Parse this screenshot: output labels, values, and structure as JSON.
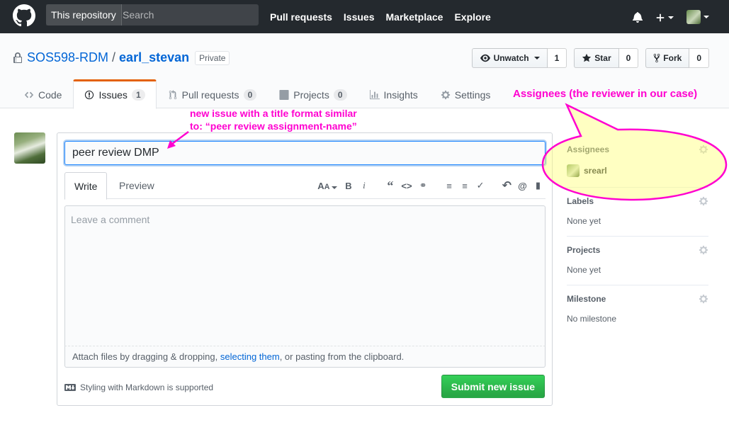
{
  "header": {
    "scope_label": "This repository",
    "search_placeholder": "Search",
    "nav": [
      "Pull requests",
      "Issues",
      "Marketplace",
      "Explore"
    ]
  },
  "repo": {
    "owner": "SOS598-RDM",
    "name": "earl_stevan",
    "visibility": "Private",
    "watch_label": "Unwatch",
    "watch_count": "1",
    "star_label": "Star",
    "star_count": "0",
    "fork_label": "Fork",
    "fork_count": "0",
    "tabs": [
      {
        "label": "Code",
        "icon": "code-icon"
      },
      {
        "label": "Issues",
        "counter": "1",
        "icon": "issue-icon"
      },
      {
        "label": "Pull requests",
        "counter": "0",
        "icon": "pull-request-icon"
      },
      {
        "label": "Projects",
        "counter": "0",
        "icon": "project-icon"
      },
      {
        "label": "Insights",
        "icon": "graph-icon"
      },
      {
        "label": "Settings",
        "icon": "gear-icon"
      }
    ]
  },
  "issue_form": {
    "title_value": "peer review DMP",
    "tab_write": "Write",
    "tab_preview": "Preview",
    "comment_placeholder": "Leave a comment",
    "attach_prefix": "Attach files by dragging & dropping,",
    "attach_link": "selecting them",
    "attach_suffix": ", or pasting from the clipboard.",
    "markdown_note": "Styling with Markdown is supported",
    "submit_label": "Submit new issue"
  },
  "sidebar": {
    "assignees_heading": "Assignees",
    "assignee_name": "srearl",
    "labels_heading": "Labels",
    "labels_value": "None yet",
    "projects_heading": "Projects",
    "projects_value": "None yet",
    "milestone_heading": "Milestone",
    "milestone_value": "No milestone"
  },
  "annotations": {
    "title_note_line1": "new issue with a title format similar",
    "title_note_line2": "to: “peer review assignment-name”",
    "assignee_note": "Assignees (the reviewer in our case)",
    "color": "#ff00d0"
  },
  "colors": {
    "header_bg": "#24292e",
    "link": "#0366d6",
    "submit_green": "#28a745",
    "selected_tab_accent": "#e36209"
  }
}
